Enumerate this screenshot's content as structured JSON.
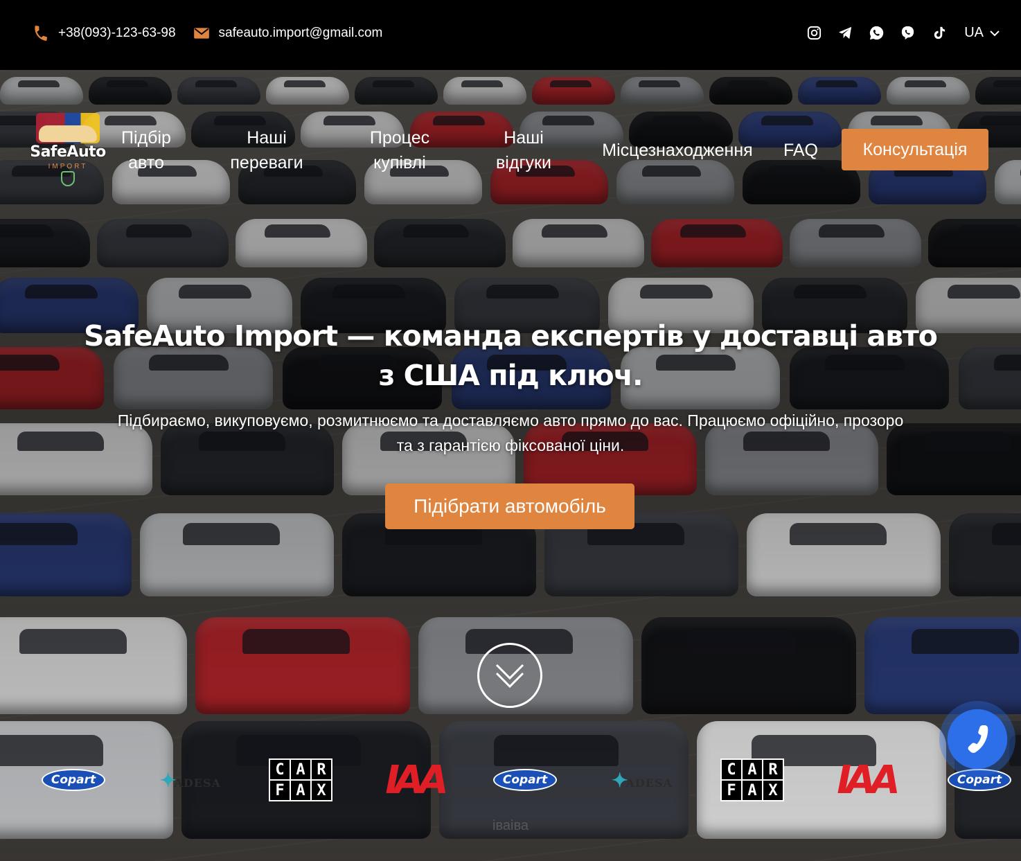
{
  "topbar": {
    "phone": "+38(093)-123-63-98",
    "email": "safeauto.import@gmail.com",
    "social_icons": [
      "instagram-icon",
      "telegram-icon",
      "whatsapp-icon",
      "viber-icon",
      "tiktok-icon"
    ],
    "language": "UA"
  },
  "nav": {
    "logo": {
      "name": "SafeAuto",
      "sub": "IMPORT"
    },
    "items": [
      {
        "label": "Підбір авто"
      },
      {
        "label": "Наші переваги"
      },
      {
        "label": "Процес купівлі"
      },
      {
        "label": "Наші відгуки"
      },
      {
        "label": "Місцезнаходження"
      },
      {
        "label": "FAQ"
      }
    ],
    "cta": "Консультація"
  },
  "hero": {
    "headline": "SafeAuto Import — команда експертів у доставці авто з США під ключ.",
    "subline": "Підбираємо, викуповуємо, розмитнюємо та доставляємо авто прямо до вас. Працюємо офіційно, прозоро та з гарантією фіксованої ціни.",
    "cta": "Підібрати автомобіль"
  },
  "partners": {
    "copart": "Copart",
    "adesa": "ADESA",
    "carfax": [
      "C",
      "A",
      "R",
      "F",
      "A",
      "X"
    ],
    "iaa": "IAA"
  },
  "watermark": "іваіва",
  "colors": {
    "accent": "#e0853f",
    "call": "#2d6fe8",
    "iaa_red": "#e01e26"
  }
}
